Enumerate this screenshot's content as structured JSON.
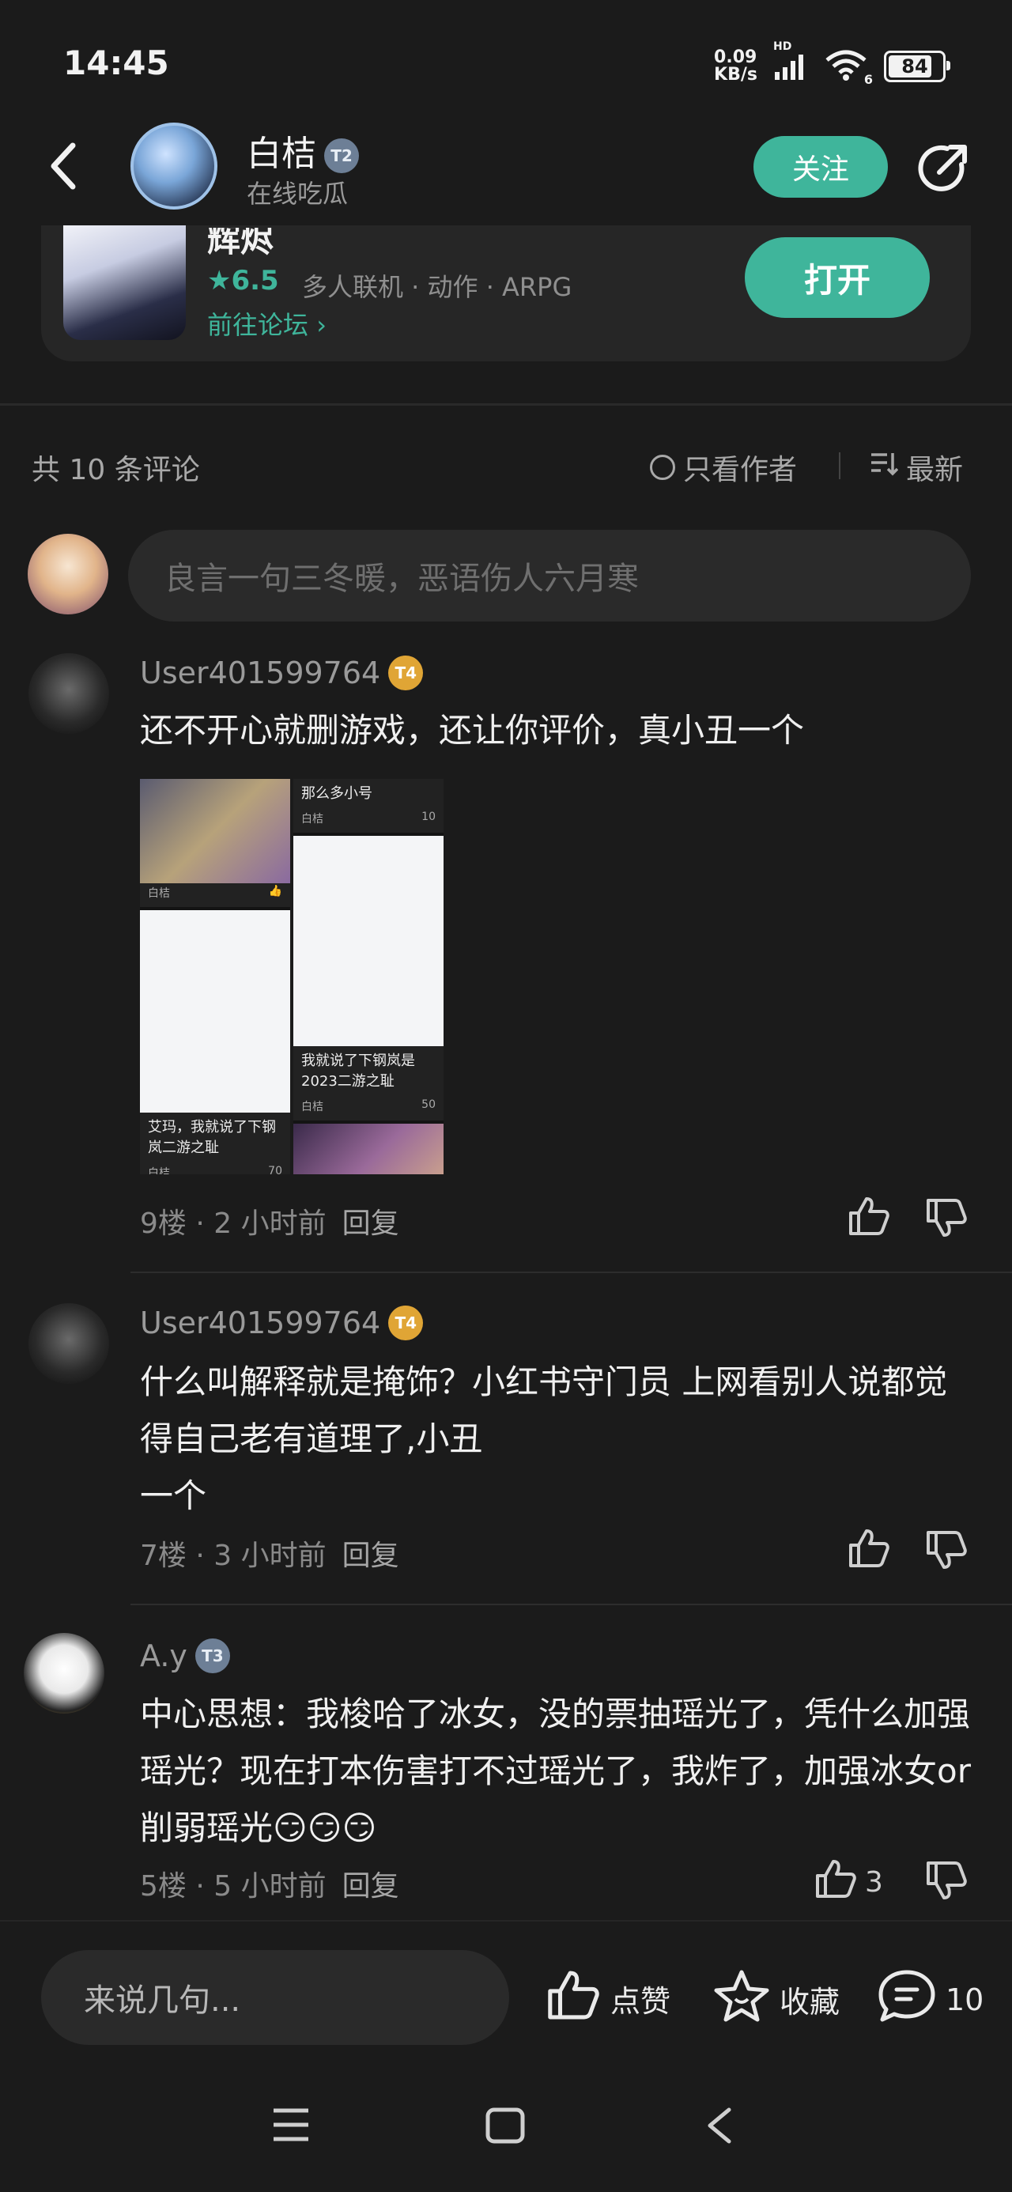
{
  "status_bar": {
    "time": "14:45",
    "net_speed_value": "0.09",
    "net_speed_unit": "KB/s",
    "signal_label": "HD",
    "wifi_label": "6",
    "battery": "84"
  },
  "header": {
    "name": "白桔",
    "level": "T2",
    "subtitle": "在线吃瓜",
    "follow_label": "关注"
  },
  "game": {
    "title": "辉烬",
    "rating": "6.5",
    "tags": "多人联机 · 动作 · ARPG",
    "forum_link": "前往论坛",
    "open_label": "打开"
  },
  "comments_bar": {
    "count_label": "共 10 条评论",
    "author_only_label": "只看作者",
    "sort_label": "最新"
  },
  "comment_input": {
    "placeholder": "良言一句三冬暖，恶语伤人六月寒"
  },
  "comments": [
    {
      "user": "User401599764",
      "level": "T4",
      "text": "还不开心就删游戏，还让你评价，真小丑一个",
      "floor": "9楼",
      "time": "2 小时前",
      "reply_label": "回复",
      "likes": "",
      "images": {
        "card1_caption": "那么多小号",
        "card1_author": "白桔",
        "card1_likes": "10",
        "card2_caption": "我就说了下钢岚是2023二游之耻",
        "card2_author": "白桔",
        "card2_likes": "50",
        "card3_author": "白桔",
        "card4_caption": "艾玛，我就说了下钢岚二游之耻",
        "card4_author": "白桔",
        "card4_likes": "70"
      }
    },
    {
      "user": "User401599764",
      "level": "T4",
      "text": "什么叫解释就是掩饰？小红书守门员 上网看别人说都觉得自己老有道理了,小丑\n一个",
      "floor": "7楼",
      "time": "3 小时前",
      "reply_label": "回复",
      "likes": ""
    },
    {
      "user": "A.y",
      "level": "T3",
      "text": "中心思想：我梭哈了冰女，没的票抽瑶光了，凭什么加强瑶光？现在打本伤害打不过瑶光了，我炸了，加强冰女or削弱瑶光😏😏😏",
      "floor": "5楼",
      "time": "5 小时前",
      "reply_label": "回复",
      "likes": "3"
    }
  ],
  "bottom_bar": {
    "input_placeholder": "来说几句...",
    "like_label": "点赞",
    "favorite_label": "收藏",
    "comment_count": "10"
  },
  "colors": {
    "accent": "#3fb59b",
    "background": "#1b1b1b",
    "badge_gold": "#e0a535",
    "badge_gray": "#6d7f96"
  }
}
